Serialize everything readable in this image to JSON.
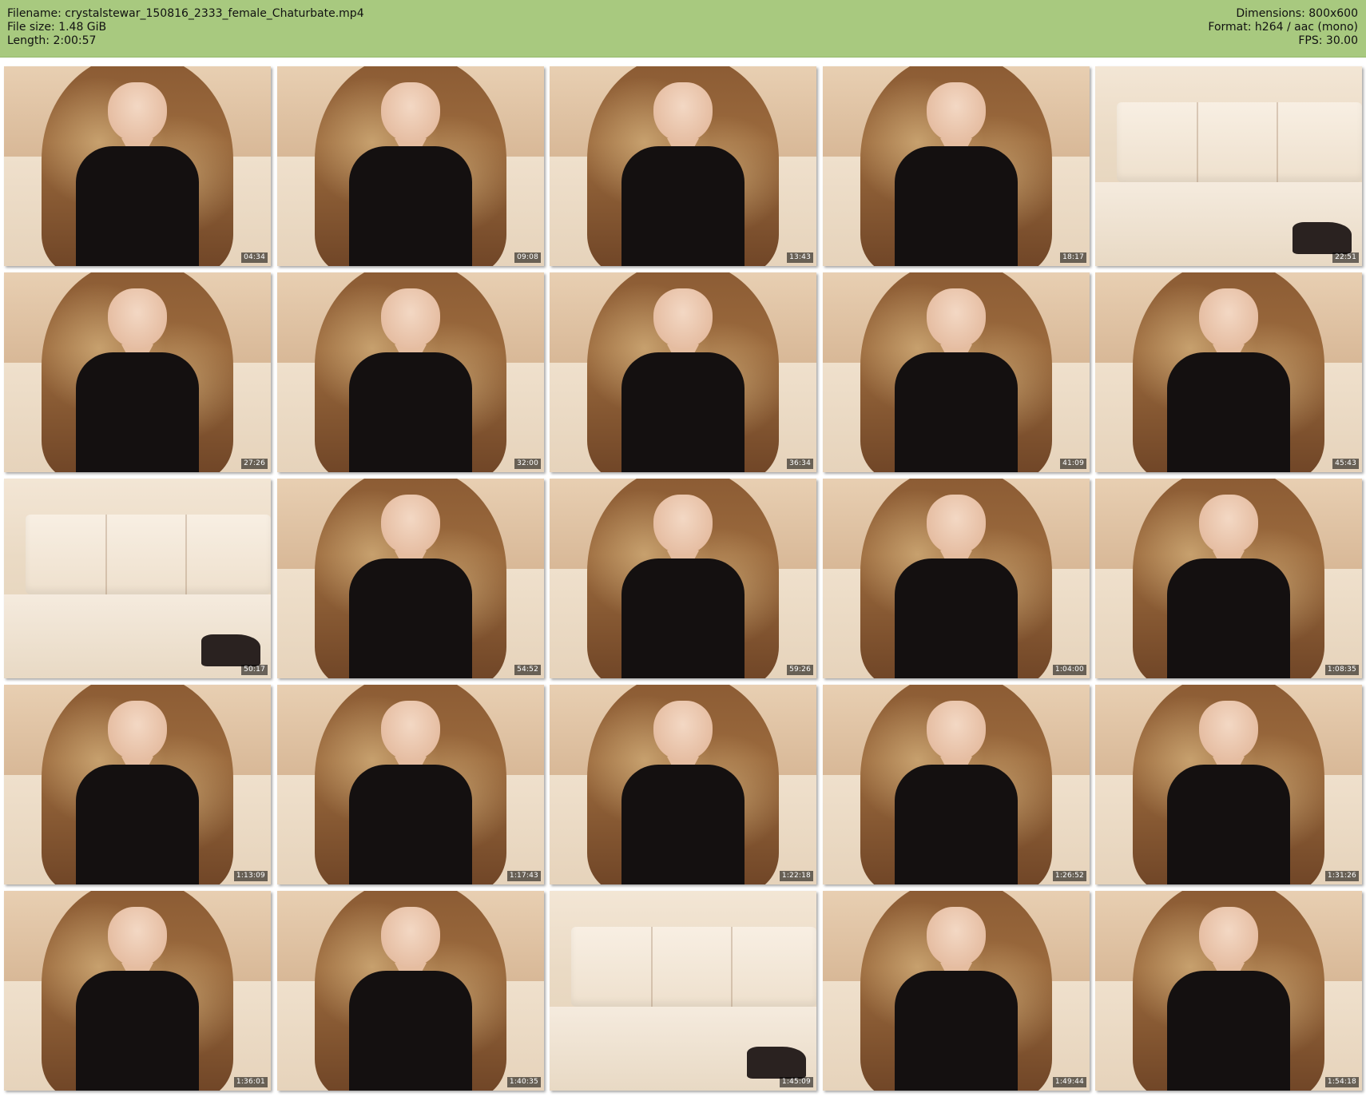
{
  "header": {
    "filename": "Filename: crystalstewar_150816_2333_female_Chaturbate.mp4",
    "filesize": "File size: 1.48 GiB",
    "length": "Length: 2:00:57",
    "dimensions": "Dimensions: 800x600",
    "format": "Format: h264 / aac (mono)",
    "fps": "FPS: 30.00",
    "bg_color": "#a8c97f"
  },
  "thumbnails": [
    {
      "timestamp": "04:34",
      "scene": "person"
    },
    {
      "timestamp": "09:08",
      "scene": "person"
    },
    {
      "timestamp": "13:43",
      "scene": "person"
    },
    {
      "timestamp": "18:17",
      "scene": "person"
    },
    {
      "timestamp": "22:51",
      "scene": "couch"
    },
    {
      "timestamp": "27:26",
      "scene": "person"
    },
    {
      "timestamp": "32:00",
      "scene": "person"
    },
    {
      "timestamp": "36:34",
      "scene": "person"
    },
    {
      "timestamp": "41:09",
      "scene": "person"
    },
    {
      "timestamp": "45:43",
      "scene": "person"
    },
    {
      "timestamp": "50:17",
      "scene": "couch"
    },
    {
      "timestamp": "54:52",
      "scene": "person"
    },
    {
      "timestamp": "59:26",
      "scene": "person"
    },
    {
      "timestamp": "1:04:00",
      "scene": "person"
    },
    {
      "timestamp": "1:08:35",
      "scene": "person"
    },
    {
      "timestamp": "1:13:09",
      "scene": "person"
    },
    {
      "timestamp": "1:17:43",
      "scene": "person"
    },
    {
      "timestamp": "1:22:18",
      "scene": "person"
    },
    {
      "timestamp": "1:26:52",
      "scene": "person"
    },
    {
      "timestamp": "1:31:26",
      "scene": "person"
    },
    {
      "timestamp": "1:36:01",
      "scene": "person"
    },
    {
      "timestamp": "1:40:35",
      "scene": "person"
    },
    {
      "timestamp": "1:45:09",
      "scene": "couch"
    },
    {
      "timestamp": "1:49:44",
      "scene": "person"
    },
    {
      "timestamp": "1:54:18",
      "scene": "person"
    }
  ]
}
